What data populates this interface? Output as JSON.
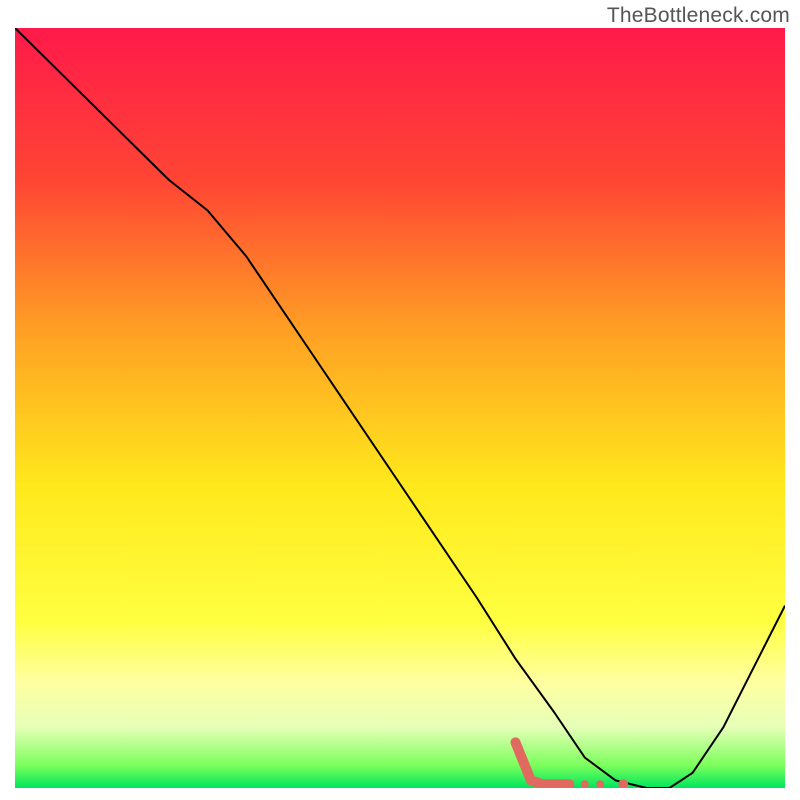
{
  "watermark": "TheBottleneck.com",
  "chart_data": {
    "type": "line",
    "title": "",
    "xlabel": "",
    "ylabel": "",
    "xlim": [
      0,
      100
    ],
    "ylim": [
      0,
      100
    ],
    "grid": false,
    "legend": false,
    "gradient_stops": [
      {
        "offset": 0.0,
        "color": "#ff1a4a"
      },
      {
        "offset": 0.2,
        "color": "#ff4534"
      },
      {
        "offset": 0.4,
        "color": "#ffa024"
      },
      {
        "offset": 0.6,
        "color": "#ffe81c"
      },
      {
        "offset": 0.78,
        "color": "#ffff40"
      },
      {
        "offset": 0.86,
        "color": "#ffffa0"
      },
      {
        "offset": 0.92,
        "color": "#e6ffb8"
      },
      {
        "offset": 0.97,
        "color": "#7cff5c"
      },
      {
        "offset": 1.0,
        "color": "#00e65c"
      }
    ],
    "series": [
      {
        "name": "bottleneck-curve",
        "stroke": "#000000",
        "stroke_width": 2,
        "x": [
          0,
          10,
          20,
          25,
          30,
          40,
          50,
          60,
          65,
          70,
          74,
          78,
          82,
          85,
          88,
          92,
          100
        ],
        "values": [
          100,
          90,
          80,
          76,
          70,
          55,
          40,
          25,
          17,
          10,
          4,
          1,
          0,
          0,
          2,
          8,
          24
        ]
      },
      {
        "name": "optimal-range-marker",
        "stroke": "#e06a60",
        "stroke_width": 10,
        "linecap": "round",
        "x": [
          65.0,
          67.0,
          68.5,
          69.5,
          72.0
        ],
        "values": [
          6.0,
          1.0,
          0.5,
          0.5,
          0.5
        ]
      }
    ],
    "marker_dots": {
      "stroke": "#e06a60",
      "points": [
        {
          "x": 74.0,
          "y": 0.5,
          "r": 4
        },
        {
          "x": 76.0,
          "y": 0.5,
          "r": 4
        },
        {
          "x": 79.0,
          "y": 0.5,
          "r": 5
        }
      ]
    }
  }
}
